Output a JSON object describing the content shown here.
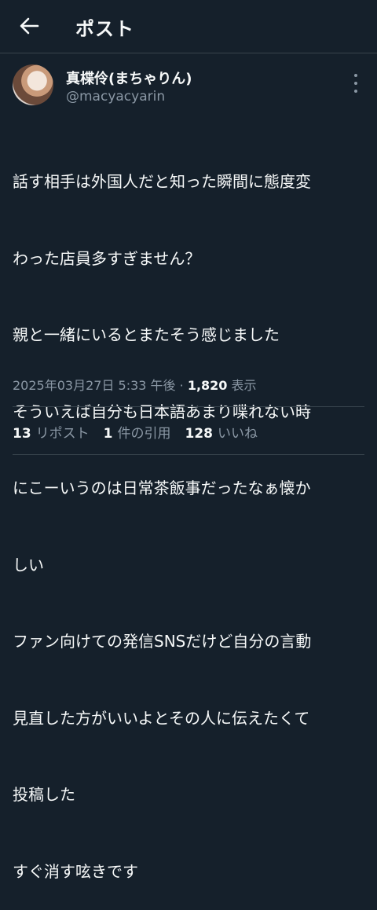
{
  "header": {
    "title": "ポスト"
  },
  "post": {
    "display_name": "真楪伶(まちゃりん)",
    "handle": "@macyacyarin",
    "lines": [
      "話す相手は外国人だと知った瞬間に態度変",
      "わった店員多すぎません？",
      "親と一緒にいるとまたそう感じました",
      "そういえば自分も日本語あまり喋れない時",
      "にこーいうのは日常茶飯事だったなぁ懐か",
      "しい",
      "ファン向けての発信SNSだけど自分の言動",
      "見直した方がいいよとその人に伝えたくて",
      "投稿した",
      "すぐ消す呟きです"
    ],
    "timestamp": "2025年03月27日 5:33 午後",
    "separator": "·",
    "views_count": "1,820",
    "views_label": "表示"
  },
  "stats": {
    "reposts_count": "13",
    "reposts_label": "リポスト",
    "quotes_count": "1",
    "quotes_label": "件の引用",
    "likes_count": "128",
    "likes_label": "いいね"
  },
  "icons": {
    "back": "back-arrow-icon",
    "more": "more-vertical-icon"
  },
  "colors": {
    "background": "#15202b",
    "text": "#f7f9f9",
    "secondary": "#8b98a5",
    "border": "#38444d"
  }
}
